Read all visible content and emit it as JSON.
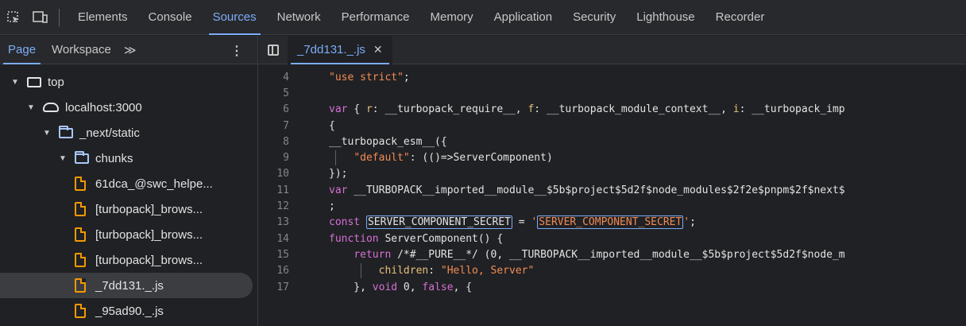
{
  "toolbar": {
    "inspect_icon": "inspect-element-icon",
    "device_icon": "device-toolbar-icon",
    "tabs": [
      "Elements",
      "Console",
      "Sources",
      "Network",
      "Performance",
      "Memory",
      "Application",
      "Security",
      "Lighthouse",
      "Recorder"
    ],
    "active_tab": "Sources"
  },
  "navigator": {
    "tabs": [
      "Page",
      "Workspace"
    ],
    "more": "≫",
    "tree": [
      {
        "label": "top",
        "indent": 0,
        "icon": "frame-icon",
        "expanded": true
      },
      {
        "label": "localhost:3000",
        "indent": 1,
        "icon": "cloud-icon",
        "expanded": true
      },
      {
        "label": "_next/static",
        "indent": 2,
        "icon": "folder-icon",
        "expanded": true
      },
      {
        "label": "chunks",
        "indent": 3,
        "icon": "folder-icon",
        "expanded": true
      },
      {
        "label": "61dca_@swc_helpe...",
        "indent": 4,
        "icon": "file-icon"
      },
      {
        "label": "[turbopack]_brows...",
        "indent": 4,
        "icon": "file-icon"
      },
      {
        "label": "[turbopack]_brows...",
        "indent": 4,
        "icon": "file-icon"
      },
      {
        "label": "[turbopack]_brows...",
        "indent": 4,
        "icon": "file-icon"
      },
      {
        "label": "_7dd131._.js",
        "indent": 4,
        "icon": "file-icon",
        "selected": true
      },
      {
        "label": "_95ad90._.js",
        "indent": 4,
        "icon": "file-icon"
      }
    ]
  },
  "editor": {
    "open_file": "_7dd131._.js",
    "close_glyph": "✕",
    "lines": [
      {
        "n": "4",
        "text": "\"use strict\";"
      },
      {
        "n": "5",
        "text": ""
      },
      {
        "n": "6",
        "text": "var { r: __turbopack_require__, f: __turbopack_module_context__, i: __turbopack_imp"
      },
      {
        "n": "7",
        "text": "{"
      },
      {
        "n": "8",
        "text": "__turbopack_esm__({"
      },
      {
        "n": "9",
        "text": "    \"default\": (()=>ServerComponent)"
      },
      {
        "n": "10",
        "text": "});"
      },
      {
        "n": "11",
        "text": "var __TURBOPACK__imported__module__$5b$project$5d2f$node_modules$2f2e$pnpm$2f$next$"
      },
      {
        "n": "12",
        "text": ";"
      },
      {
        "n": "13",
        "text": "const SERVER_COMPONENT_SECRET = 'SERVER_COMPONENT_SECRET';"
      },
      {
        "n": "14",
        "text": "function ServerComponent() {"
      },
      {
        "n": "15",
        "text": "    return /*#__PURE__*/ (0, __TURBOPACK__imported__module__$5b$project$5d2f$node_m"
      },
      {
        "n": "16",
        "text": "        children: \"Hello, Server\""
      },
      {
        "n": "17",
        "text": "    }, void 0, false, {"
      }
    ]
  }
}
